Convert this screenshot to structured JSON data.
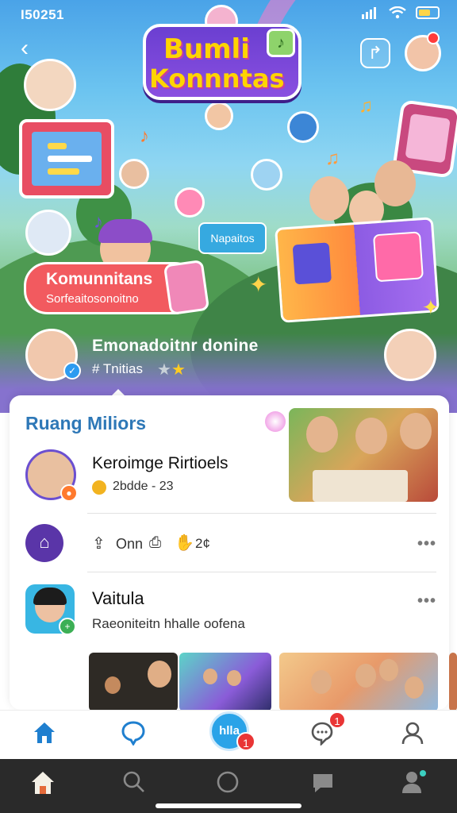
{
  "status_bar": {
    "left_text": "I50251",
    "icons": [
      "wifi-icon",
      "signal-icon",
      "battery-icon"
    ]
  },
  "hero": {
    "logo_line1": "Bumli",
    "logo_line2": "Konnntas",
    "tag": "Napaitos",
    "pill_title": "Komunnitans",
    "pill_subtitle": "Sorfeaitosonoitno",
    "profile_name": "Emonadoitnr donine",
    "profile_subtitle": "# Tnitias"
  },
  "card": {
    "section_title": "Ruang Miliors",
    "row1": {
      "title": "Keroimge Rirtioels",
      "meta": "2bdde - 23"
    },
    "row2": {
      "label": "Onn",
      "count": "2¢"
    },
    "row3": {
      "title": "Vaitula",
      "subtitle": "Raeoniteitn hhalle oofena"
    }
  },
  "bottom_nav": {
    "items": [
      "home",
      "discover",
      "center",
      "chat",
      "profile"
    ],
    "center_label": "hlla",
    "center_badge": "1",
    "chat_badge": "1"
  },
  "colors": {
    "accent": "#2aa3e8",
    "section_title": "#2e78b7",
    "badge": "#e93535",
    "pill": "#f25a5f"
  }
}
